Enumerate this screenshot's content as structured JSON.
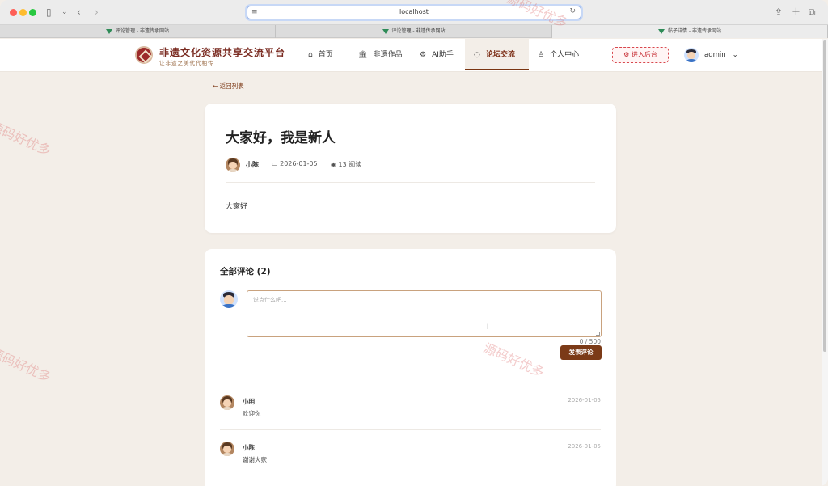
{
  "browser": {
    "url": "localhost"
  },
  "tabs": [
    {
      "title": "评论管理 - 非遗传承网站"
    },
    {
      "title": "评论管理 - 非遗传承网站"
    },
    {
      "title": "帖子详情 - 非遗传承网站"
    }
  ],
  "site": {
    "name": "非遗文化资源共享交流平台",
    "slogan": "让非遗之美代代相传"
  },
  "nav": {
    "items": [
      {
        "label": "首页",
        "icon": "home-icon"
      },
      {
        "label": "非遗作品",
        "icon": "museum-icon"
      },
      {
        "label": "AI助手",
        "icon": "robot-icon"
      },
      {
        "label": "论坛交流",
        "icon": "chat-icon",
        "active": true
      },
      {
        "label": "个人中心",
        "icon": "user-icon"
      }
    ],
    "admin_button": "进入后台",
    "user": "admin"
  },
  "post": {
    "back": "返回列表",
    "title": "大家好，我是新人",
    "author": "小陈",
    "date": "2026-01-05",
    "views": "13 阅读",
    "body": "大家好"
  },
  "comments": {
    "header": "全部评论 (2)",
    "placeholder": "说点什么吧...",
    "counter": "0 / 500",
    "submit": "发表评论",
    "list": [
      {
        "name": "小明",
        "text": "欢迎你",
        "date": "2026-01-05"
      },
      {
        "name": "小陈",
        "text": "谢谢大家",
        "date": "2026-01-05"
      }
    ]
  },
  "watermark": "源码好优多"
}
